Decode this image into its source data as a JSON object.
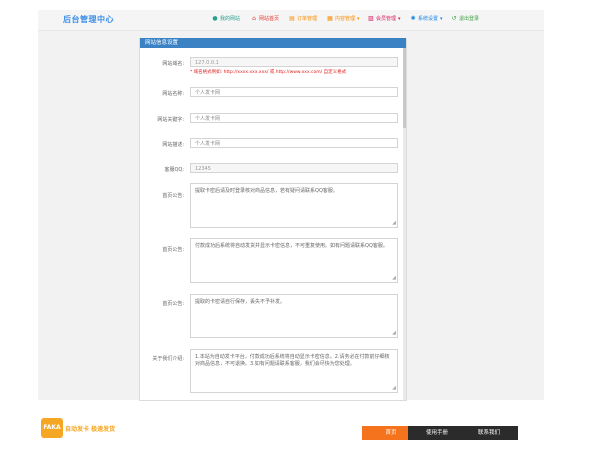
{
  "app": {
    "title": "后台管理中心"
  },
  "nav": [
    {
      "label": "我的网站",
      "icon": "person-icon",
      "color": "#2a9d8f",
      "has_caret": false
    },
    {
      "label": "网站首页",
      "icon": "home-icon",
      "color": "#e53935",
      "has_caret": false
    },
    {
      "label": "订单管理",
      "icon": "list-icon",
      "color": "#fb8c00",
      "has_caret": false
    },
    {
      "label": "内容管理",
      "icon": "doc-icon",
      "color": "#fb8c00",
      "has_caret": true
    },
    {
      "label": "会员管理",
      "icon": "users-icon",
      "color": "#d81b60",
      "has_caret": true
    },
    {
      "label": "系统设置",
      "icon": "gear-icon",
      "color": "#1e88e5",
      "has_caret": true
    },
    {
      "label": "退出登录",
      "icon": "logout-icon",
      "color": "#43a047",
      "has_caret": false
    }
  ],
  "panel": {
    "title": "网站信息设置"
  },
  "form": {
    "domain": {
      "label": "网站域名:",
      "value": "127.0.0.1",
      "hint": "* 域名格式例如: http://xxxx.xxx.xxx/ 或 http://www.xxx.com/ 自定义格式"
    },
    "site_name": {
      "label": "网站名称:",
      "value": "个人发卡网"
    },
    "keywords": {
      "label": "网站关键字:",
      "value": "个人发卡网"
    },
    "description": {
      "label": "网站描述:",
      "value": "个人发卡网"
    },
    "qq": {
      "label": "客服QQ:",
      "value": "12345"
    },
    "notice1": {
      "label": "首页公告:",
      "value": "提取卡密后请及时登录核对商品信息，若有疑问请联系QQ客服。"
    },
    "notice2": {
      "label": "首页公告:",
      "value": "付款成功后系统将自动发货并显示卡密信息，不可重复使用。如有问题请联系QQ客服。"
    },
    "notice3": {
      "label": "首页公告:",
      "value": "提取的卡密请自行保存，丢失不予补发。"
    },
    "about": {
      "label": "关于我们介绍:",
      "value": "1.本站为自动发卡平台，付款成功后系统将自动显示卡密信息。2.请务必在付款前仔细核对商品信息，不可退换。3.如有问题请联系客服，我们会尽快为您处理。"
    }
  },
  "footer": {
    "logo_mark": "FAKA",
    "logo_text": "自动发卡 极速发货",
    "buttons": [
      {
        "label": "首页",
        "color": "#f5731d"
      },
      {
        "label": "使用手册",
        "color": "#2b2b2b"
      },
      {
        "label": "联系我们",
        "color": "#2b2b2b"
      }
    ]
  }
}
